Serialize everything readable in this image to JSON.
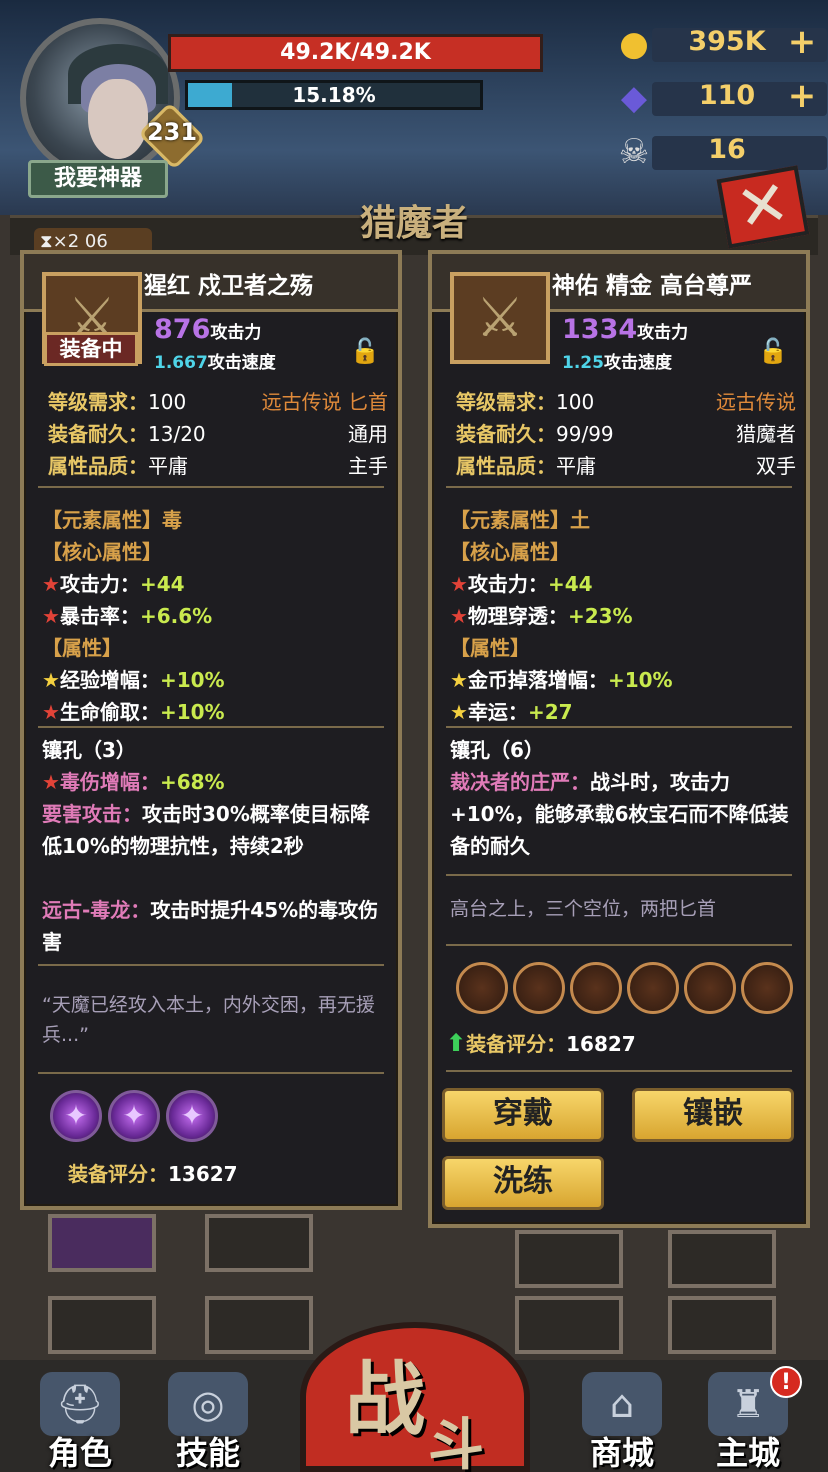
{
  "player": {
    "level": "231",
    "hp": "49.2K/49.2K",
    "xp_text": "15.18%",
    "xp_fraction": 0.1518,
    "want_button": "我要神器"
  },
  "resources": {
    "gold": "395K",
    "gems": "110",
    "tickets": "16",
    "plus": "+"
  },
  "header": {
    "title": "猎魔者",
    "close": "✕",
    "hourglass": "⧗×2  06"
  },
  "left_item": {
    "name": "猩红 戍卫者之殇",
    "equipped_label": "装备中",
    "attack_value": "876",
    "attack_label": "攻击力",
    "speed_value": "1.667",
    "speed_label": "攻击速度",
    "rows": [
      {
        "label": "等级需求：",
        "value": "100",
        "right": "远古传说 匕首",
        "right_color": "orange"
      },
      {
        "label": "装备耐久：",
        "value": "13/20",
        "right": "通用"
      },
      {
        "label": "属性品质：",
        "value": "平庸",
        "right": "主手"
      }
    ],
    "element": "【元素属性】毒",
    "core_head": "【核心属性】",
    "core_stats": [
      {
        "star": "★",
        "name": "攻击力：",
        "value": "+44"
      },
      {
        "star": "★",
        "name": "暴击率：",
        "value": "+6.6%"
      }
    ],
    "attr_head": "【属性】",
    "attr_stats": [
      {
        "star": "★",
        "name": "经验增幅：",
        "value": "+10%",
        "color": "yellow"
      },
      {
        "star": "★",
        "name": "生命偷取：",
        "value": "+10%",
        "color": "red"
      }
    ],
    "sockets_label": "镶孔（3）",
    "socket_stat": {
      "star": "★",
      "name": "毒伤增幅：",
      "value": "+68%"
    },
    "skill1_name": "要害攻击：",
    "skill1_text": "攻击时30%概率使目标降低10%的物理抗性，持续2秒",
    "skill2_name": "远古-毒龙：",
    "skill2_text": "攻击时提升45%的毒攻伤害",
    "flavor": "“天魔已经攻入本土，内外交困，再无援兵...”",
    "score_label": "装备评分：",
    "score": "13627"
  },
  "right_item": {
    "name": "神佑 精金 高台尊严",
    "attack_value": "1334",
    "attack_label": "攻击力",
    "speed_value": "1.25",
    "speed_label": "攻击速度",
    "rows": [
      {
        "label": "等级需求：",
        "value": "100",
        "right": "远古传说",
        "right_color": "orange"
      },
      {
        "label": "装备耐久：",
        "value": "99/99",
        "right": "猎魔者"
      },
      {
        "label": "属性品质：",
        "value": "平庸",
        "right": "双手"
      }
    ],
    "element": "【元素属性】土",
    "core_head": "【核心属性】",
    "core_stats": [
      {
        "star": "★",
        "name": "攻击力：",
        "value": "+44"
      },
      {
        "star": "★",
        "name": "物理穿透：",
        "value": "+23%"
      }
    ],
    "attr_head": "【属性】",
    "attr_stats": [
      {
        "star": "★",
        "name": "金币掉落增幅：",
        "value": "+10%",
        "color": "yellow"
      },
      {
        "star": "★",
        "name": "幸运：",
        "value": "+27",
        "color": "yellow"
      }
    ],
    "sockets_label": "镶孔（6）",
    "skill1_name": "裁决者的庄严：",
    "skill1_text": "战斗时，攻击力+10%，能够承载6枚宝石而不降低装备的耐久",
    "flavor": "高台之上，三个空位，两把匕首",
    "score_label": "装备评分：",
    "score": "16827",
    "buttons": {
      "wear": "穿戴",
      "inlay": "镶嵌",
      "refine": "洗练"
    }
  },
  "nav": {
    "character": "角色",
    "skills": "技能",
    "battle_1": "战",
    "battle_2": "斗",
    "shop": "商城",
    "city": "主城",
    "alert": "!"
  },
  "colors": {
    "gold": "#f4cf6a",
    "hp": "#c62f24",
    "xp": "#3daad1",
    "attack_purple": "#b873e6",
    "green_value": "#c9ea4e"
  }
}
